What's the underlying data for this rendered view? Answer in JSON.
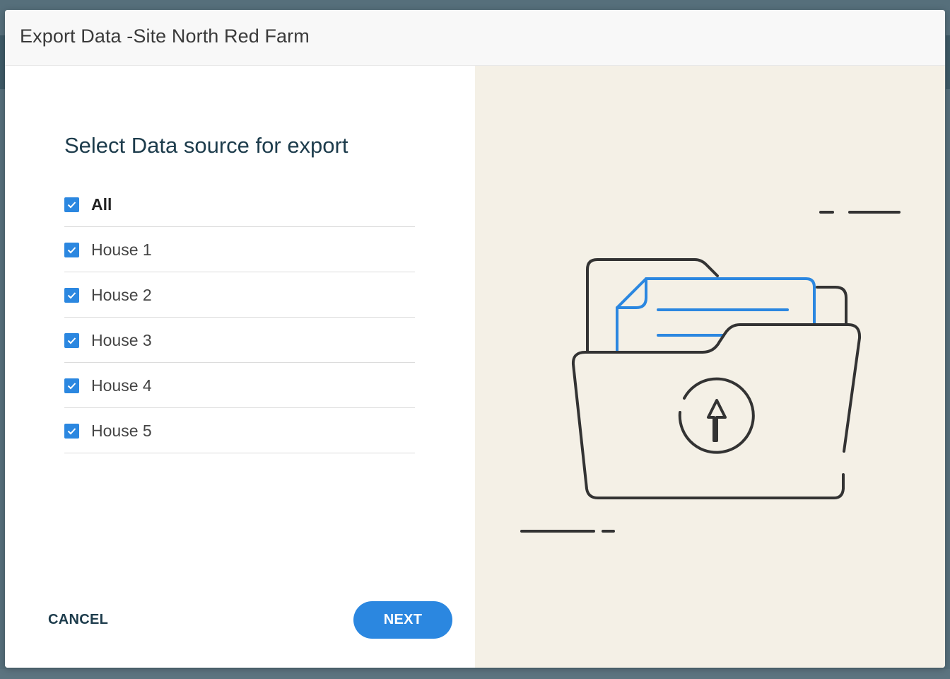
{
  "dialog": {
    "title": "Export Data -Site North Red Farm",
    "section_title": "Select Data source for export"
  },
  "sources": [
    {
      "label": "All",
      "checked": true
    },
    {
      "label": "House 1",
      "checked": true
    },
    {
      "label": "House 2",
      "checked": true
    },
    {
      "label": "House 3",
      "checked": true
    },
    {
      "label": "House 4",
      "checked": true
    },
    {
      "label": "House 5",
      "checked": true
    }
  ],
  "actions": {
    "cancel_label": "CANCEL",
    "next_label": "NEXT"
  },
  "illustration": {
    "icon": "folder-upload-icon",
    "accent_color": "#2b87e0",
    "panel_color": "#f4f0e6"
  }
}
